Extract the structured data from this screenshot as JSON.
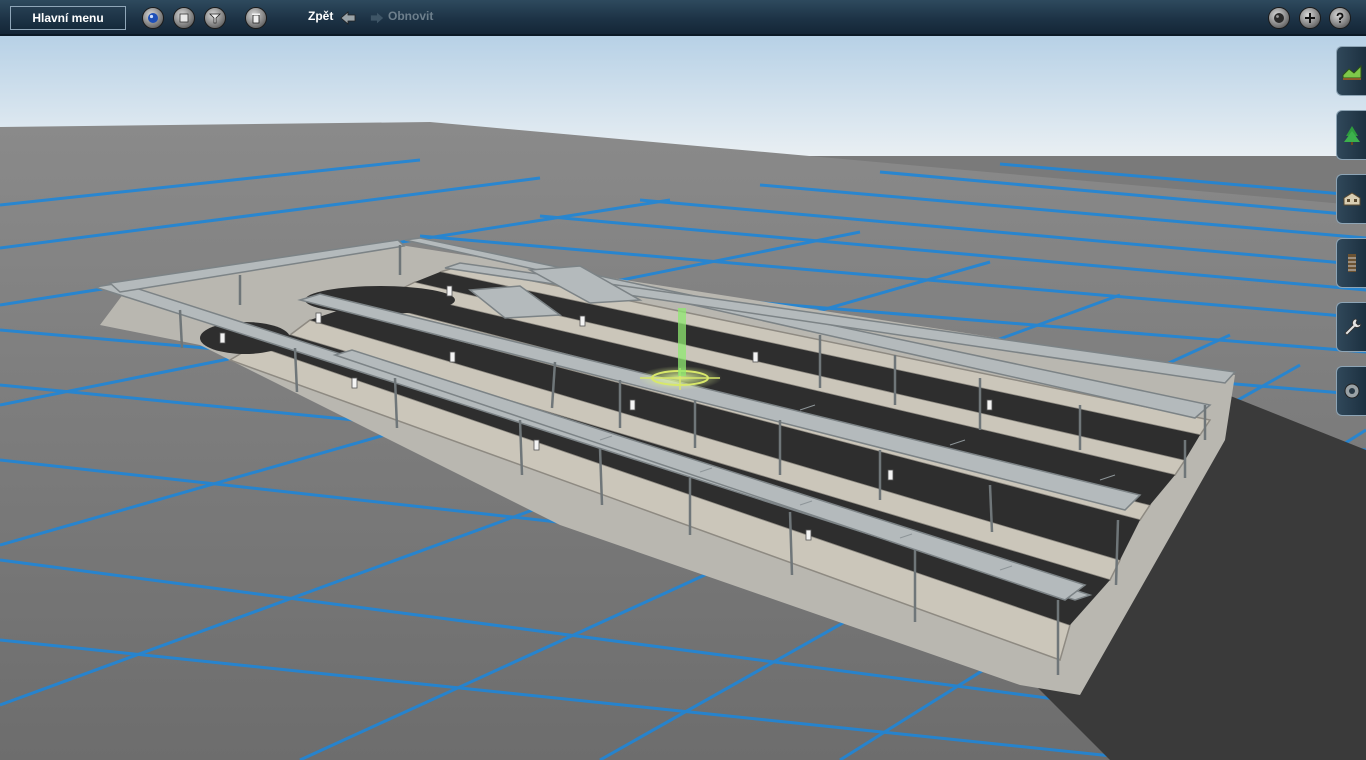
{
  "toolbar": {
    "main_menu_label": "Hlavní menu",
    "undo_label": "Zpět",
    "redo_label": "Obnovit",
    "left_tools": [
      {
        "name": "blue-sphere-icon"
      },
      {
        "name": "stop-square-icon"
      },
      {
        "name": "filter-icon"
      },
      {
        "name": "trash-icon"
      }
    ],
    "right_tools": [
      {
        "name": "dark-sphere-icon"
      },
      {
        "name": "plus-icon"
      },
      {
        "name": "help-icon"
      }
    ]
  },
  "side_palette": {
    "tabs": [
      {
        "name": "terrain-tab",
        "icon": "terrain-icon"
      },
      {
        "name": "scenery-tab",
        "icon": "tree-icon"
      },
      {
        "name": "buildings-tab",
        "icon": "building-icon"
      },
      {
        "name": "track-tab",
        "icon": "track-icon"
      },
      {
        "name": "tools-tab",
        "icon": "wrench-icon"
      },
      {
        "name": "settings-tab",
        "icon": "gear-icon"
      }
    ]
  },
  "colors": {
    "toolbar": "#1d3346",
    "grid_line": "#1f86d8",
    "ground": "#7a7a7a",
    "sky": "#dbe8f2",
    "platform": "#c7c3b8",
    "roof": "#b4babc",
    "track_bed": "#3a3a3a",
    "marker": "#8fe870"
  }
}
